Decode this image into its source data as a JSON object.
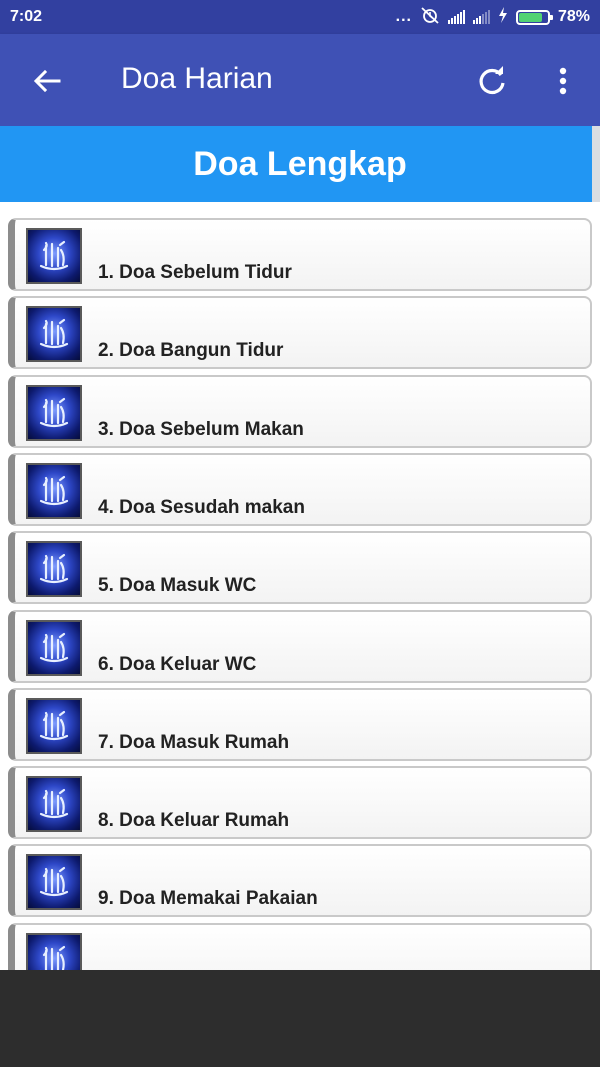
{
  "status_bar": {
    "time": "7:02",
    "dots": "...",
    "battery_percent": "78%",
    "battery_level": 0.78,
    "icons": [
      "more-dots-icon",
      "alarm-off-icon",
      "signal-icon",
      "signal-icon",
      "charging-icon",
      "battery-icon"
    ]
  },
  "app_bar": {
    "title": "Doa Harian",
    "back_icon": "arrow-back-icon",
    "refresh_icon": "refresh-icon",
    "menu_icon": "more-vert-icon"
  },
  "section": {
    "title": "Doa Lengkap"
  },
  "list": {
    "items": [
      {
        "label": "1. Doa Sebelum Tidur"
      },
      {
        "label": "2. Doa Bangun Tidur"
      },
      {
        "label": "3. Doa Sebelum Makan"
      },
      {
        "label": "4. Doa Sesudah makan"
      },
      {
        "label": "5. Doa Masuk WC"
      },
      {
        "label": "6. Doa Keluar WC"
      },
      {
        "label": "7. Doa Masuk Rumah"
      },
      {
        "label": "8. Doa Keluar Rumah"
      },
      {
        "label": "9. Doa Memakai Pakaian"
      },
      {
        "label": ""
      }
    ]
  },
  "colors": {
    "status_bar": "#3240a0",
    "app_bar": "#3f51b5",
    "section_header": "#2196f3",
    "bottom_area": "#2d2d2d"
  }
}
